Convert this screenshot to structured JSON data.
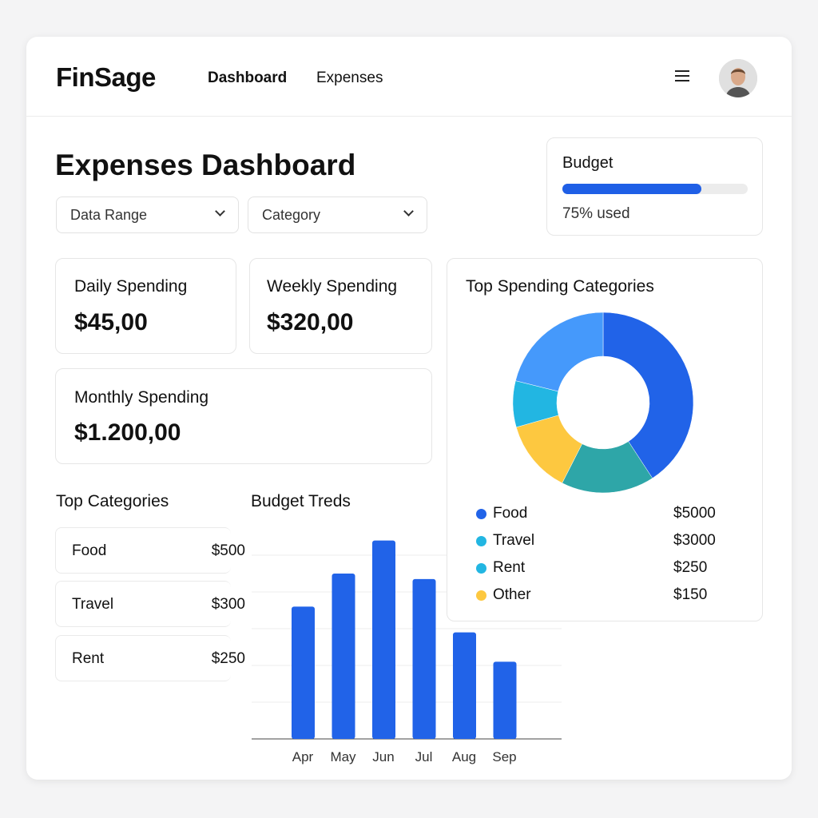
{
  "header": {
    "logo": "FinSage",
    "nav": [
      {
        "label": "Dashboard",
        "active": true
      },
      {
        "label": "Expenses",
        "active": false
      }
    ],
    "menu_icon": "hamburger-icon",
    "avatar": "user-avatar"
  },
  "page": {
    "title": "Expenses Dashboard"
  },
  "filters": [
    {
      "label": "Data Range"
    },
    {
      "label": "Category"
    }
  ],
  "budget": {
    "label": "Budget",
    "percent": 75,
    "status": "75% used",
    "color": "#1f5fe6"
  },
  "stats": [
    {
      "label": "Daily Spending",
      "value": "$45,00"
    },
    {
      "label": "Weekly Spending",
      "value": "$320,00"
    },
    {
      "label": "Monthly Spending",
      "value": "$1.200,00"
    }
  ],
  "top_categories": {
    "title": "Top Categories",
    "items": [
      {
        "name": "Food",
        "amount": "$500"
      },
      {
        "name": "Travel",
        "amount": "$300"
      },
      {
        "name": "Rent",
        "amount": "$250"
      }
    ]
  },
  "chart_data": [
    {
      "type": "bar",
      "title": "Budget Treds",
      "categories": [
        "Apr",
        "May",
        "Jun",
        "Jul",
        "Aug",
        "Sep"
      ],
      "values": [
        3.6,
        4.5,
        5.4,
        4.35,
        2.9,
        2.1
      ],
      "ylim": [
        0,
        5
      ],
      "grid": true,
      "color": "#2163e8"
    },
    {
      "type": "pie",
      "title": "Top Spending Categories",
      "donut": true,
      "slices": [
        {
          "name": "Food",
          "percent": 40.8,
          "color": "#2163e8"
        },
        {
          "percent": 16.7,
          "color": "#2ea6a8"
        },
        {
          "name": "Other",
          "percent": 13.1,
          "color": "#fdc840"
        },
        {
          "name": "Rent",
          "percent": 8.3,
          "color": "#22b6e2"
        },
        {
          "percent": 21.1,
          "color": "#4599fb"
        }
      ],
      "legend": [
        {
          "name": "Food",
          "value": "$5000",
          "color": "#2163e8"
        },
        {
          "name": "Travel",
          "value": "$3000",
          "color": "#22b6e2"
        },
        {
          "name": "Rent",
          "value": "$250",
          "color": "#22b6e2"
        },
        {
          "name": "Other",
          "value": "$150",
          "color": "#fdc840"
        }
      ],
      "legend_placement": "bottom"
    }
  ]
}
